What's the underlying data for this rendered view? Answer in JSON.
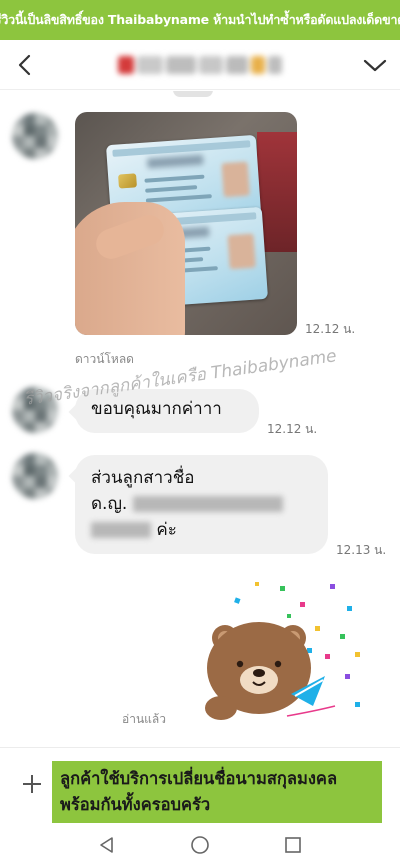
{
  "banner": {
    "text": "รีวิวนี้เป็นลิขสิทธิ์ของ Thaibabyname ห้ามนำไปทำซ้ำหรือดัดแปลงเด็ดขาด"
  },
  "header": {
    "back_icon": "chevron-left-icon",
    "menu_icon": "chevron-down-icon"
  },
  "messages": [
    {
      "type": "image",
      "description": "id-card-photo",
      "time": "12.12 น.",
      "action": "ดาวน์โหลด"
    },
    {
      "type": "text",
      "text": "ขอบคุณมากค่าาา",
      "time": "12.12 น."
    },
    {
      "type": "text",
      "line1": "ส่วนลูกสาวชื่อ",
      "prefix": "ด.ญ.",
      "suffix": "ค่ะ",
      "time": "12.13 น."
    },
    {
      "type": "sticker",
      "sticker_name": "brown-bear-sticker",
      "status": "อ่านแล้ว"
    }
  ],
  "watermark": {
    "text": "รีวิวจริงจากลูกค้าในเครือ Thaibabyname"
  },
  "composer": {
    "plus_icon": "plus-icon",
    "promo_line1": "ลูกค้าใช้บริการเปลี่ยนชื่อนามสกุลมงคล",
    "promo_line2": "พร้อมกันทั้งครอบครัว"
  },
  "navbar": {
    "back_icon": "nav-back-icon",
    "home_icon": "nav-home-icon",
    "recents_icon": "nav-recents-icon"
  },
  "colors": {
    "brand_green": "#8dc53e",
    "bubble_gray": "#f0f0f0"
  }
}
